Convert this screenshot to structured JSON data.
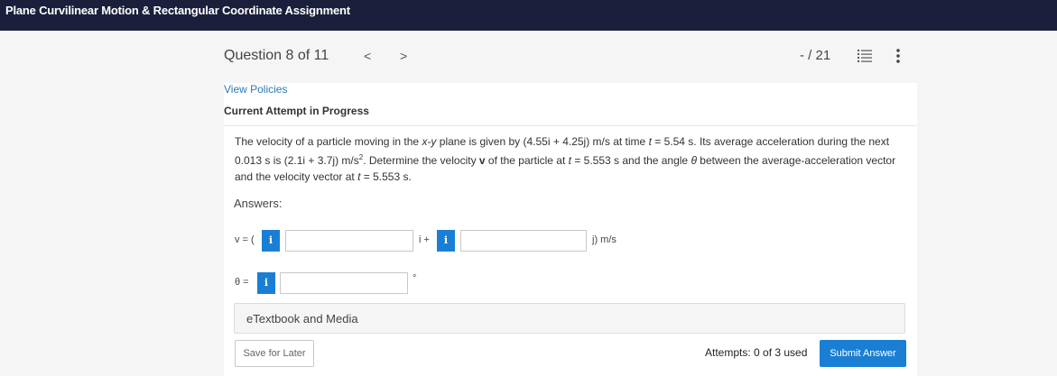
{
  "app": {
    "title": "Plane Curvilinear Motion & Rectangular Coordinate Assignment"
  },
  "header": {
    "question_counter": "Question 8 of 11",
    "prev_label": "<",
    "next_label": ">",
    "score": "- / 21",
    "list_icon": "list-icon",
    "more_icon": "more-vertical-icon"
  },
  "policies_link": "View Policies",
  "attempt_status": "Current Attempt in Progress",
  "problem": {
    "p1": "The velocity of a particle moving in the ",
    "p1_it": "x-y",
    "p2": " plane is given by (4.55i + 4.25j) m/s at time ",
    "p2_it": "t",
    "p3": " = 5.54 s. Its average acceleration during the next 0.013 s is (2.1i + 3.7j) m/s",
    "p3_sup": "2",
    "p4": ". Determine the velocity ",
    "p4_v": "v",
    "p5": " of the particle at ",
    "p5_it": "t",
    "p6": " = 5.553 s and the angle ",
    "p6_theta": "θ",
    "p7": " between the average-acceleration vector and the velocity vector at ",
    "p7_it": "t",
    "p8": " = 5.553 s."
  },
  "answers": {
    "label": "Answers:",
    "v_label": "v = (",
    "i_label": "i +",
    "j_label": "j) m/s",
    "theta_label": "θ =",
    "deg_label": "°",
    "info_symbol": "i",
    "v_i_value": "",
    "v_j_value": "",
    "theta_value": ""
  },
  "etextbook": "eTextbook and Media",
  "footer": {
    "save_label": "Save for Later",
    "attempts_text": "Attempts: 0 of 3 used",
    "submit_label": "Submit Answer"
  },
  "colors": {
    "topbar": "#1b1f3b",
    "accent": "#1a7fd4",
    "link": "#2a7ab8"
  }
}
